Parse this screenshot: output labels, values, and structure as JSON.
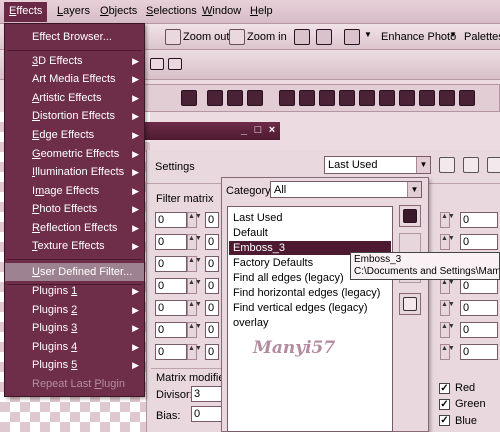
{
  "menubar": {
    "items": [
      {
        "label": "Effects",
        "ul": "E",
        "rest": "ffects",
        "selected": true
      },
      {
        "label": "Layers",
        "ul": "L",
        "rest": "ayers"
      },
      {
        "label": "Objects",
        "ul": "O",
        "rest": "bjects"
      },
      {
        "label": "Selections",
        "ul": "S",
        "rest": "elections"
      },
      {
        "label": "Window",
        "ul": "W",
        "rest": "indow"
      },
      {
        "label": "Help",
        "ul": "H",
        "rest": "elp"
      }
    ]
  },
  "toolbar": {
    "zoom_out": "Zoom out",
    "zoom_in": "Zoom in",
    "enhance_photo": "Enhance Photo",
    "palettes": "Palettes"
  },
  "effects_menu": {
    "items": [
      {
        "pre": "Effect Browser...",
        "ul": "",
        "post": "",
        "sub": false
      },
      {
        "pre": "",
        "ul": "3",
        "post": "D Effects",
        "sub": true
      },
      {
        "pre": "Art Media Effects",
        "ul": "",
        "post": "",
        "sub": true
      },
      {
        "pre": "",
        "ul": "A",
        "post": "rtistic Effects",
        "sub": true
      },
      {
        "pre": "",
        "ul": "D",
        "post": "istortion Effects",
        "sub": true
      },
      {
        "pre": "",
        "ul": "E",
        "post": "dge Effects",
        "sub": true
      },
      {
        "pre": "",
        "ul": "G",
        "post": "eometric Effects",
        "sub": true
      },
      {
        "pre": "",
        "ul": "I",
        "post": "llumination Effects",
        "sub": true
      },
      {
        "pre": "I",
        "ul": "m",
        "post": "age Effects",
        "sub": true
      },
      {
        "pre": "",
        "ul": "P",
        "post": "hoto Effects",
        "sub": true
      },
      {
        "pre": "",
        "ul": "R",
        "post": "eflection Effects",
        "sub": true
      },
      {
        "pre": "",
        "ul": "T",
        "post": "exture Effects",
        "sub": true
      },
      {
        "pre": "",
        "ul": "U",
        "post": "ser Defined Filter...",
        "sub": false,
        "highlighted": true
      },
      {
        "pre": "Plugins ",
        "ul": "1",
        "post": "",
        "sub": true
      },
      {
        "pre": "Plugins ",
        "ul": "2",
        "post": "",
        "sub": true
      },
      {
        "pre": "Plugins ",
        "ul": "3",
        "post": "",
        "sub": true
      },
      {
        "pre": "Plugins ",
        "ul": "4",
        "post": "",
        "sub": true
      },
      {
        "pre": "Plugins ",
        "ul": "5",
        "post": "",
        "sub": true
      },
      {
        "pre": "Repeat Last ",
        "ul": "P",
        "post": "lugin",
        "sub": false,
        "disabled": true
      }
    ]
  },
  "dialog": {
    "settings_label": "Settings",
    "settings_value": "Last Used",
    "filter_matrix_label": "Filter matrix",
    "matrix_value": "0",
    "matrix_modifiers_label": "Matrix modifiers",
    "divisor_label": "Divisor:",
    "divisor_value": "3",
    "bias_label": "Bias:",
    "bias_value": "0",
    "channels": [
      {
        "label": "Red",
        "checked": true
      },
      {
        "label": "Green",
        "checked": true
      },
      {
        "label": "Blue",
        "checked": true
      }
    ]
  },
  "preset_popup": {
    "category_label": "Category:",
    "category_value": "All",
    "items": [
      {
        "label": "Last Used"
      },
      {
        "label": "Default"
      },
      {
        "label": "Emboss_3",
        "selected": true
      },
      {
        "label": "Factory Defaults"
      },
      {
        "label": "Find all edges (legacy)"
      },
      {
        "label": "Find horizontal edges (legacy)"
      },
      {
        "label": "Find vertical edges (legacy)"
      },
      {
        "label": "overlay"
      }
    ],
    "tooltip_title": "Emboss_3",
    "tooltip_path": "C:\\Documents and Settings\\Mama\\[",
    "signature": "Manyi57"
  },
  "colors": {
    "accent": "#6e2d49",
    "selection": "#4d1a31",
    "menu_highlight": "#9d8391"
  }
}
